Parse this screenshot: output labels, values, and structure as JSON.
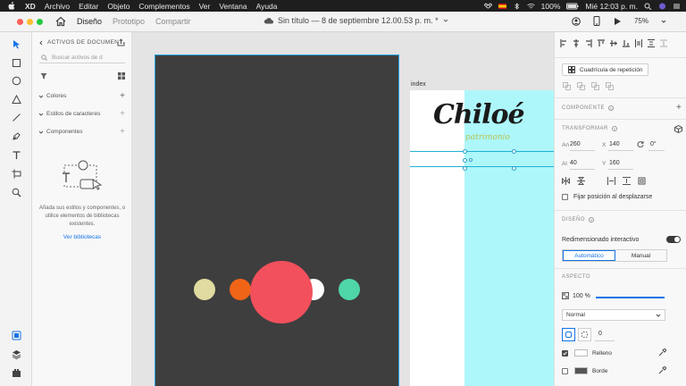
{
  "menubar": {
    "items": [
      "XD",
      "Archivo",
      "Editar",
      "Objeto",
      "Complementos",
      "Ver",
      "Ventana",
      "Ayuda"
    ],
    "battery": "100%",
    "clock": "Mié 12:03 p. m."
  },
  "titlebar": {
    "tabs": [
      "Diseño",
      "Prototipo",
      "Compartir"
    ],
    "active_tab": "Diseño",
    "document_title": "Sin título — 8 de septiembre 12.00.53 p. m. *",
    "zoom": "75%"
  },
  "assets": {
    "header": "ACTIVOS DE DOCUMEN...",
    "search_placeholder": "Buscar activos de d",
    "sections": [
      "Colores",
      "Estilos de caracteres",
      "Componentes"
    ],
    "empty_message": "Añada sus estilos y componentes, o utilice elementos de bibliotecas existentes.",
    "link": "Ver bibliotecas"
  },
  "canvas": {
    "artboard_label": "index",
    "logo_text": "Chiloé",
    "logo_subtitle": "patrimonio",
    "circle_colors": [
      "#e0dba0",
      "#f06418",
      "#f1505c",
      "#ffffff",
      "#4fd6a8"
    ],
    "artboard_cyan": "#adf7fb"
  },
  "properties": {
    "repeat_grid": "Cuadrícula de repetición",
    "component_section": "COMPONENTE",
    "transform_section": "TRANSFORMAR",
    "w_label": "An",
    "w_value": "260",
    "x_label": "X",
    "x_value": "140",
    "rotation_value": "0°",
    "h_label": "Al",
    "h_value": "40",
    "y_label": "Y",
    "y_value": "160",
    "fix_position": "Fijar posición al desplazarse",
    "design_section": "DISEÑO",
    "responsive_resize": "Redimensionado interactivo",
    "seg_auto": "Automático",
    "seg_manual": "Manual",
    "appearance_section": "ASPECTO",
    "opacity": "100 %",
    "opacity_fraction": 1.0,
    "blend_mode": "Normal",
    "corner_radius": "0",
    "fill_label": "Relleno",
    "border_label": "Borde",
    "fill_color": "#ffffff",
    "border_color": "#555555",
    "accent": "#1473e6"
  }
}
